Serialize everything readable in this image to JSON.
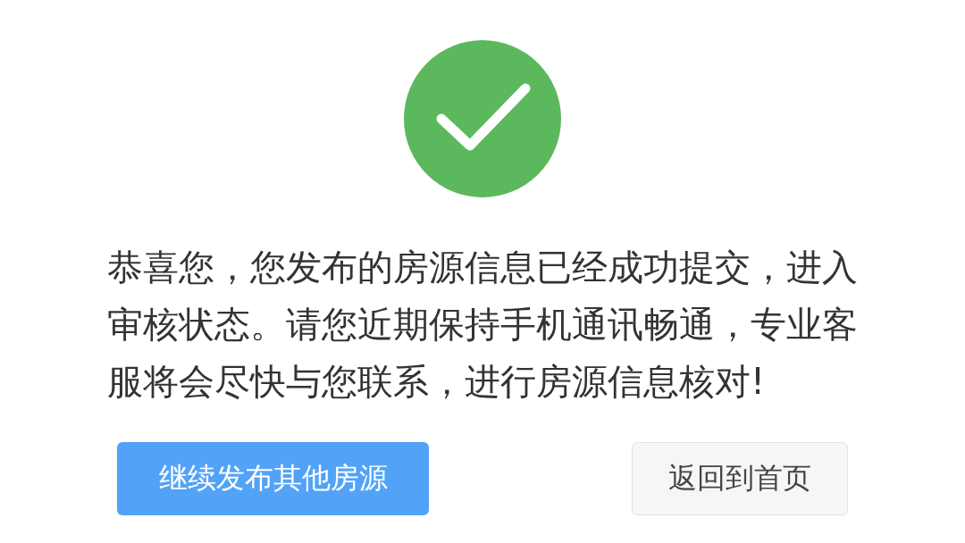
{
  "status": {
    "kind": "success"
  },
  "message": "恭喜您，您发布的房源信息已经成功提交，进入审核状态。请您近期保持手机通讯畅通，专业客服将会尽快与您联系，进行房源信息核对!",
  "buttons": [
    {
      "label": "继续发布其他房源",
      "kind": "primary"
    },
    {
      "label": "返回到首页",
      "kind": "secondary"
    }
  ]
}
